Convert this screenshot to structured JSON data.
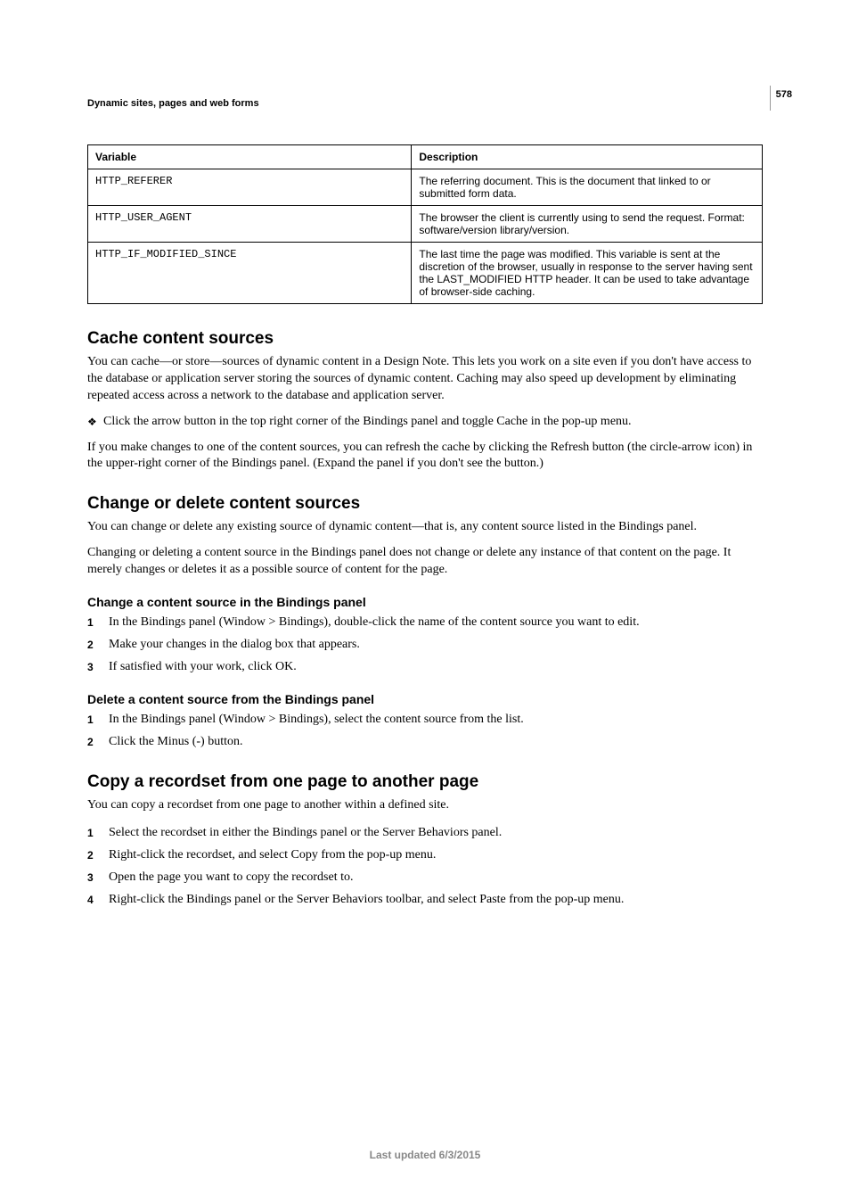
{
  "page_number": "578",
  "section_header": "Dynamic sites, pages and web forms",
  "table": {
    "headers": {
      "col1": "Variable",
      "col2": "Description"
    },
    "rows": [
      {
        "variable": "HTTP_REFERER",
        "description": "The referring document. This is the document that linked to or submitted form data."
      },
      {
        "variable": "HTTP_USER_AGENT",
        "description": "The browser the client is currently using to send the request. Format: software/version library/version."
      },
      {
        "variable": "HTTP_IF_MODIFIED_SINCE",
        "description": "The last time the page was modified. This variable is sent at the discretion of the browser, usually in response to the server having sent the LAST_MODIFIED HTTP header. It can be used to take advantage of browser-side caching."
      }
    ]
  },
  "sections": {
    "cache": {
      "title": "Cache content sources",
      "p1": "You can cache—or store—sources of dynamic content in a Design Note. This lets you work on a site even if you don't have access to the database or application server storing the sources of dynamic content. Caching may also speed up development by eliminating repeated access across a network to the database and application server.",
      "bullet": "Click the arrow button in the top right corner of the Bindings panel and toggle Cache in the pop-up menu.",
      "p2": "If you make changes to one of the content sources, you can refresh the cache by clicking the Refresh button (the circle-arrow icon) in the upper-right corner of the Bindings panel. (Expand the panel if you don't see the button.)"
    },
    "change_delete": {
      "title": "Change or delete content sources",
      "p1": "You can change or delete any existing source of dynamic content—that is, any content source listed in the Bindings panel.",
      "p2": "Changing or deleting a content source in the Bindings panel does not change or delete any instance of that content on the page. It merely changes or deletes it as a possible source of content for the page.",
      "sub1": {
        "title": "Change a content source in the Bindings panel",
        "steps": [
          "In the Bindings panel (Window > Bindings), double-click the name of the content source you want to edit.",
          "Make your changes in the dialog box that appears.",
          "If satisfied with your work, click OK."
        ]
      },
      "sub2": {
        "title": "Delete a content source from the Bindings panel",
        "steps": [
          "In the Bindings panel (Window > Bindings), select the content source from the list.",
          "Click the Minus (-) button."
        ]
      }
    },
    "copy": {
      "title": "Copy a recordset from one page to another page",
      "p1": "You can copy a recordset from one page to another within a defined site.",
      "steps": [
        "Select the recordset in either the Bindings panel or the Server Behaviors panel.",
        "Right-click the recordset, and select Copy from the pop-up menu.",
        "Open the page you want to copy the recordset to.",
        "Right-click the Bindings panel or the Server Behaviors toolbar, and select Paste from the pop-up menu."
      ]
    }
  },
  "footer": "Last updated 6/3/2015"
}
